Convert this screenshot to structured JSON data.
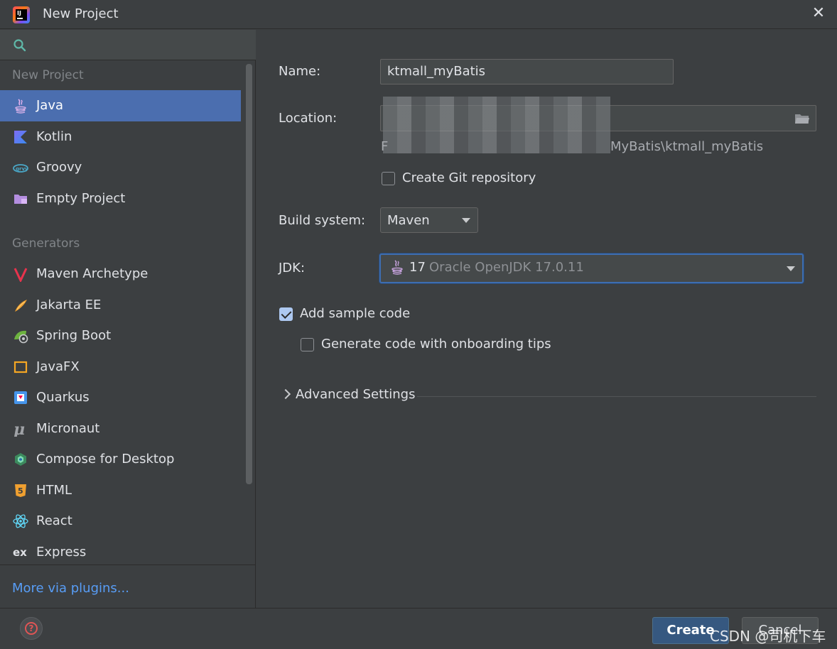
{
  "window": {
    "title": "New Project",
    "close_label": "✕"
  },
  "sidebar": {
    "sections": [
      {
        "header": "New Project",
        "items": [
          {
            "label": "Java",
            "icon": "java-icon",
            "selected": true
          },
          {
            "label": "Kotlin",
            "icon": "kotlin-icon"
          },
          {
            "label": "Groovy",
            "icon": "groovy-icon"
          },
          {
            "label": "Empty Project",
            "icon": "empty-project-icon"
          }
        ]
      },
      {
        "header": "Generators",
        "items": [
          {
            "label": "Maven Archetype",
            "icon": "maven-icon"
          },
          {
            "label": "Jakarta EE",
            "icon": "jakarta-ee-icon"
          },
          {
            "label": "Spring Boot",
            "icon": "spring-boot-icon"
          },
          {
            "label": "JavaFX",
            "icon": "javafx-icon"
          },
          {
            "label": "Quarkus",
            "icon": "quarkus-icon"
          },
          {
            "label": "Micronaut",
            "icon": "micronaut-icon"
          },
          {
            "label": "Compose for Desktop",
            "icon": "compose-icon"
          },
          {
            "label": "HTML",
            "icon": "html-icon"
          },
          {
            "label": "React",
            "icon": "react-icon"
          },
          {
            "label": "Express",
            "icon": "express-icon"
          }
        ]
      }
    ],
    "more_plugins_link": "More via plugins..."
  },
  "form": {
    "name_label": "Name:",
    "name_value": "ktmall_myBatis",
    "location_label": "Location:",
    "location_hint_prefix": "F",
    "location_hint_suffix": "MyBatis\\ktmall_myBatis",
    "create_git_label": "Create Git repository",
    "create_git_checked": false,
    "build_system_label": "Build system:",
    "build_system_value": "Maven",
    "jdk_label": "JDK:",
    "jdk_version": "17",
    "jdk_name": "Oracle OpenJDK 17.0.11",
    "add_sample_label": "Add sample code",
    "add_sample_checked": true,
    "onboarding_label": "Generate code with onboarding tips",
    "onboarding_checked": false,
    "advanced_label": "Advanced Settings"
  },
  "footer": {
    "create_label": "Create",
    "cancel_label": "Cancel",
    "help_icon": "help-icon"
  },
  "watermark": "CSDN @司机下车",
  "colors": {
    "selection": "#4b6eaf",
    "link": "#589df6",
    "primary_button": "#365880",
    "background": "#3c3f41"
  }
}
